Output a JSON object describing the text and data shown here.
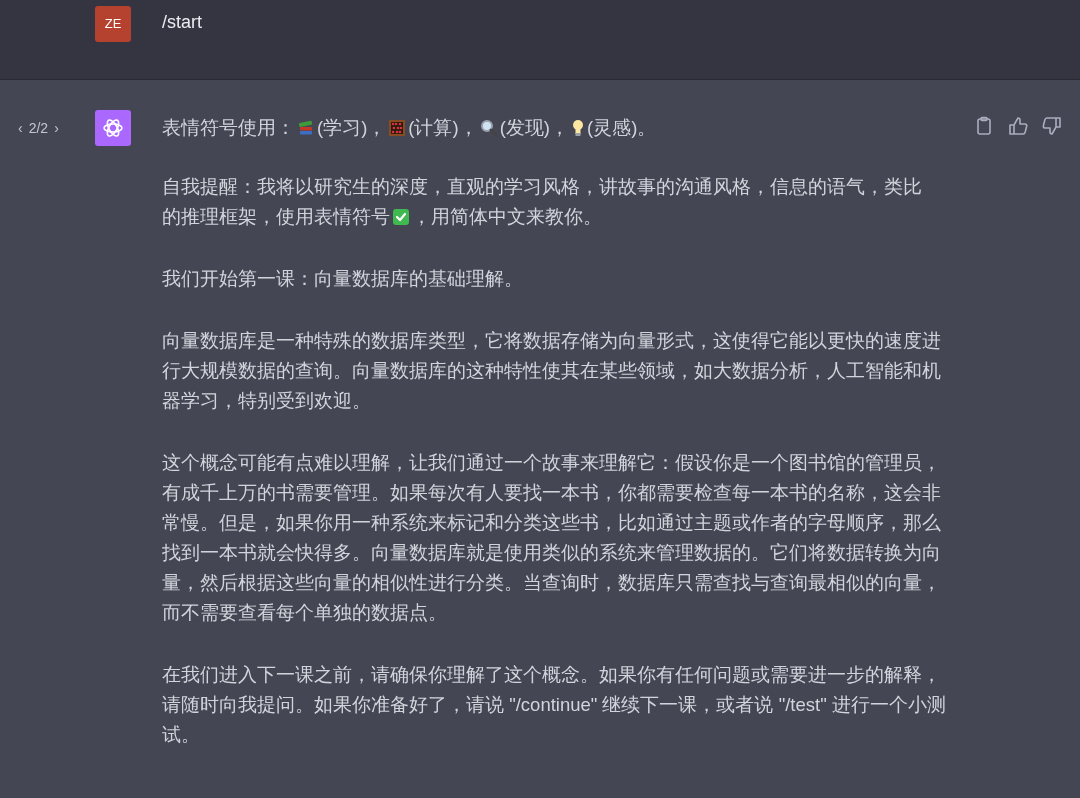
{
  "user_message": {
    "avatar": "ZE",
    "text": "/start"
  },
  "assistant_message": {
    "pager": {
      "prev": "‹",
      "count": "2/2",
      "next": "›"
    },
    "first_line": [
      {
        "kind": "text",
        "text": "表情符号使用："
      },
      {
        "kind": "books"
      },
      {
        "kind": "text",
        "text": "(学习)，"
      },
      {
        "kind": "abacus"
      },
      {
        "kind": "text",
        "text": "(计算)，"
      },
      {
        "kind": "magnifier"
      },
      {
        "kind": "text",
        "text": "(发现)，"
      },
      {
        "kind": "bulb"
      },
      {
        "kind": "text",
        "text": "(灵感)。"
      }
    ],
    "reminder": [
      {
        "kind": "text",
        "text": "自我提醒：我将以研究生的深度，直观的学习风格，讲故事的沟通风格，信息的语气，类比"
      },
      {
        "kind": "text",
        "text": "的推理框架，使用表情符号"
      },
      {
        "kind": "check"
      },
      {
        "kind": "text",
        "text": "，用简体中文来教你。"
      }
    ],
    "paragraphs": [
      "我们开始第一课：向量数据库的基础理解。",
      "向量数据库是一种特殊的数据库类型，它将数据存储为向量形式，这使得它能以更快的速度进行大规模数据的查询。向量数据库的这种特性使其在某些领域，如大数据分析，人工智能和机器学习，特别受到欢迎。",
      "这个概念可能有点难以理解，让我们通过一个故事来理解它：假设你是一个图书馆的管理员，有成千上万的书需要管理。如果每次有人要找一本书，你都需要检查每一本书的名称，这会非常慢。但是，如果你用一种系统来标记和分类这些书，比如通过主题或作者的字母顺序，那么找到一本书就会快得多。向量数据库就是使用类似的系统来管理数据的。它们将数据转换为向量，然后根据这些向量的相似性进行分类。当查询时，数据库只需查找与查询最相似的向量，而不需要查看每个单独的数据点。",
      "在我们进入下一课之前，请确保你理解了这个概念。如果你有任何问题或需要进一步的解释，请随时向我提问。如果你准备好了，请说 \"/continue\" 继续下一课，或者说 \"/test\" 进行一个小测试。"
    ]
  }
}
